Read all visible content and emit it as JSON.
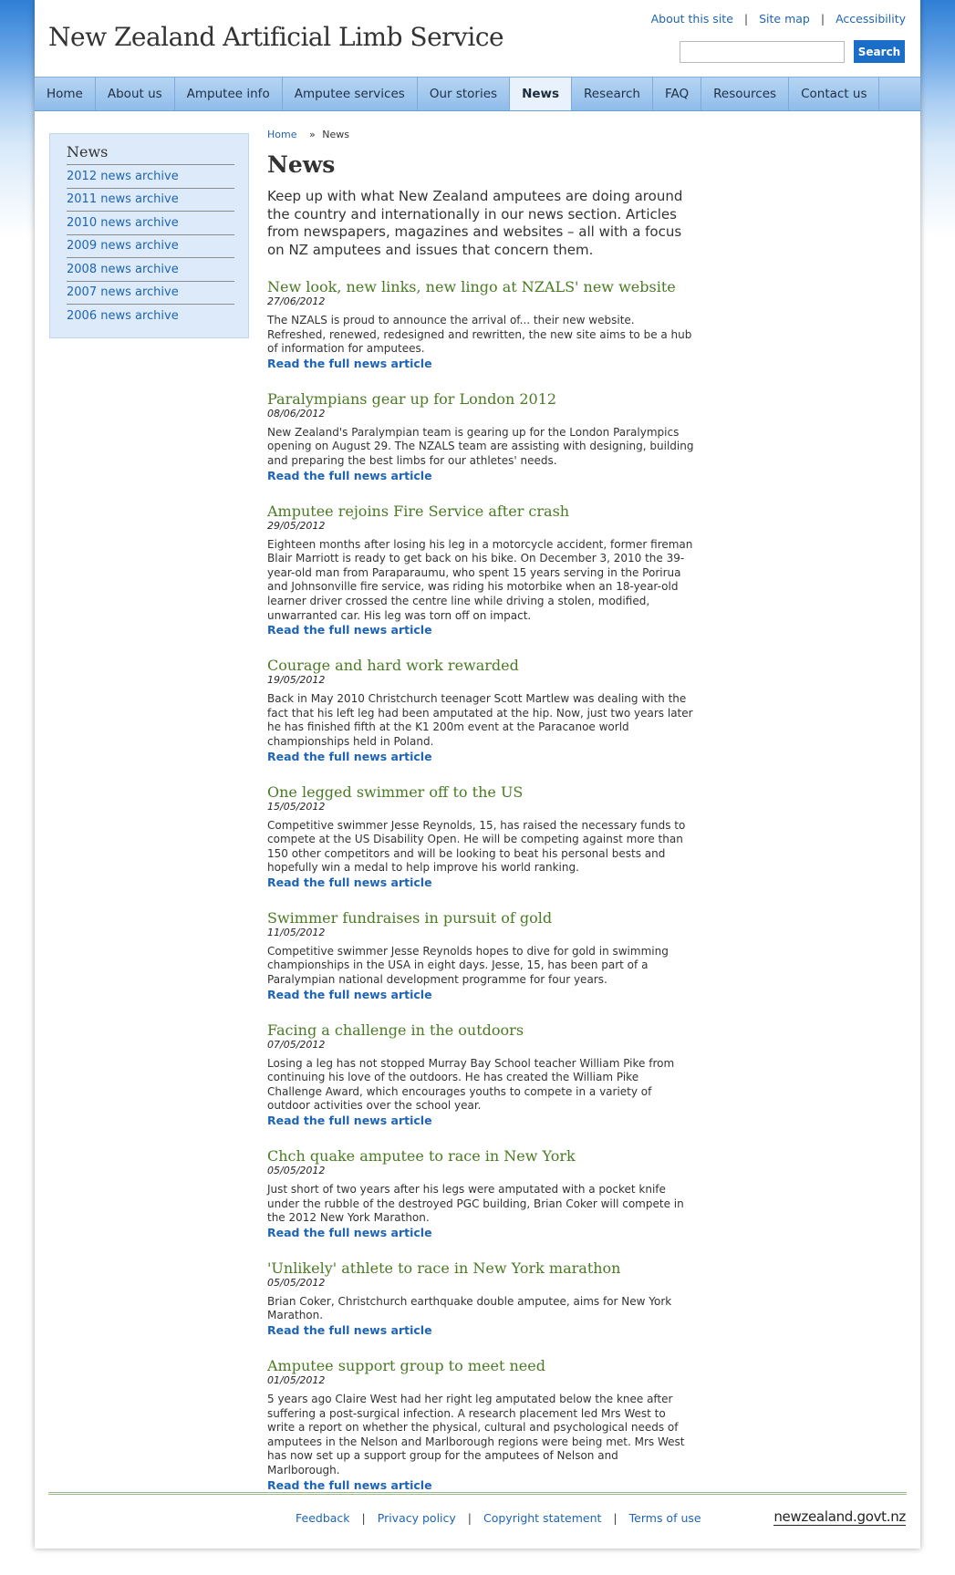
{
  "header": {
    "site_title": "New Zealand Artificial Limb Service",
    "util_links": [
      "About this site",
      "Site map",
      "Accessibility"
    ],
    "search_placeholder": "",
    "search_button": "Search"
  },
  "nav": [
    "Home",
    "About us",
    "Amputee info",
    "Amputee services",
    "Our stories",
    "News",
    "Research",
    "FAQ",
    "Resources",
    "Contact us"
  ],
  "nav_active": "News",
  "sidebar": {
    "title": "News",
    "items": [
      "2012 news archive",
      "2011 news archive",
      "2010 news archive",
      "2009 news archive",
      "2008 news archive",
      "2007 news archive",
      "2006 news archive"
    ]
  },
  "breadcrumb": {
    "home": "Home",
    "separator": "»",
    "current": "News"
  },
  "main": {
    "title": "News",
    "intro": "Keep up with what New Zealand amputees are doing around the country and internationally in our news section. Articles from newspapers, magazines and websites – all with a focus on NZ amputees and issues that concern them.",
    "read_more": "Read the full news article",
    "articles": [
      {
        "title": "New look, new links, new lingo at NZALS' new website",
        "date": "27/06/2012",
        "body": "The NZALS is proud to announce the arrival of... their new website. Refreshed, renewed, redesigned and rewritten, the new site aims to be a hub of information for amputees."
      },
      {
        "title": "Paralympians gear up for London 2012",
        "date": "08/06/2012",
        "body": "New Zealand's Paralympian team is gearing up for the London Paralympics opening on August 29. The NZALS team are assisting with designing, building and preparing the best limbs for our athletes' needs."
      },
      {
        "title": "Amputee rejoins Fire Service after crash",
        "date": "29/05/2012",
        "body": "Eighteen months after losing his leg in a motorcycle accident, former fireman Blair Marriott is ready to get back on his bike. On December 3, 2010 the 39-year-old man from Paraparaumu, who spent 15 years serving in the Porirua and Johnsonville fire service, was riding his motorbike when an 18-year-old learner driver crossed the centre line while driving a stolen, modified, unwarranted car. His leg was torn off on impact."
      },
      {
        "title": "Courage and hard work rewarded",
        "date": "19/05/2012",
        "body": "Back in May 2010 Christchurch teenager Scott Martlew was dealing with the fact that his left leg had been amputated at the hip. Now, just two years later he has finished fifth at the K1 200m event at the Paracanoe world championships held in Poland."
      },
      {
        "title": "One legged swimmer off to the US",
        "date": "15/05/2012",
        "body": "Competitive swimmer Jesse Reynolds, 15, has raised the necessary funds to compete at the US Disability Open. He will be competing against more than 150 other competitors and will be looking to beat his personal bests and hopefully win a medal to help improve his world ranking."
      },
      {
        "title": "Swimmer fundraises in pursuit of gold",
        "date": "11/05/2012",
        "body": "Competitive swimmer Jesse Reynolds hopes to dive for gold in swimming championships in the USA in eight days. Jesse, 15, has been part of a Paralympian national development programme for four years."
      },
      {
        "title": "Facing a challenge in the outdoors",
        "date": "07/05/2012",
        "body": "Losing a leg has not stopped Murray Bay School teacher William Pike from continuing his love of the outdoors. He has created the William Pike Challenge Award, which encourages youths to compete in a variety of outdoor activities over the school year."
      },
      {
        "title": "Chch quake amputee to race in New York",
        "date": "05/05/2012",
        "body": "Just short of two years after his legs were amputated with a pocket knife under the rubble of the destroyed PGC building, Brian Coker will compete in the 2012 New York Marathon."
      },
      {
        "title": "'Unlikely' athlete to race in New York marathon",
        "date": "05/05/2012",
        "body": "Brian Coker, Christchurch earthquake double amputee, aims for New York Marathon."
      },
      {
        "title": "Amputee support group to meet need",
        "date": "01/05/2012",
        "body": "5 years ago Claire West had her right leg amputated below the knee after suffering a post-surgical infection. A research placement led Mrs West to write a report on whether the physical, cultural and psychological needs of amputees in the Nelson and Marlborough regions were being met. Mrs West has now set up a support group for the amputees of Nelson and Marlborough."
      }
    ]
  },
  "footer": {
    "links": [
      "Feedback",
      "Privacy policy",
      "Copyright statement",
      "Terms of use"
    ],
    "logo": "newzealand.govt.nz"
  }
}
